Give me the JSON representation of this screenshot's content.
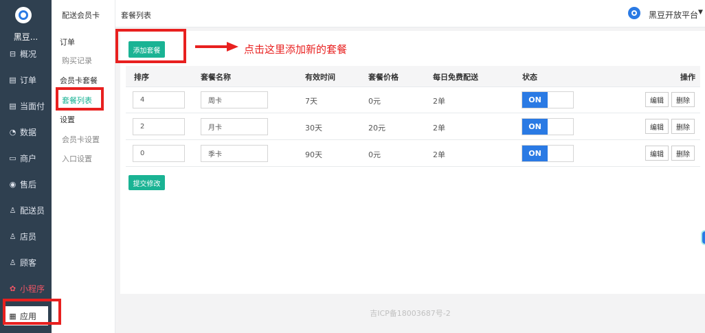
{
  "sidebar": {
    "brand": "黑豆...",
    "items": [
      {
        "label": "概况",
        "icon": "overview-icon",
        "glyph": "⊟"
      },
      {
        "label": "订单",
        "icon": "order-icon",
        "glyph": "▤"
      },
      {
        "label": "当面付",
        "icon": "face-pay-icon",
        "glyph": "▤"
      },
      {
        "label": "数据",
        "icon": "data-icon",
        "glyph": "◔"
      },
      {
        "label": "商户",
        "icon": "merchant-icon",
        "glyph": "▭"
      },
      {
        "label": "售后",
        "icon": "after-sale-icon",
        "glyph": "◉"
      },
      {
        "label": "配送员",
        "icon": "courier-icon",
        "glyph": "♙"
      },
      {
        "label": "店员",
        "icon": "clerk-icon",
        "glyph": "♙"
      },
      {
        "label": "顾客",
        "icon": "customer-icon",
        "glyph": "♙"
      },
      {
        "label": "小程序",
        "icon": "mini-program-icon",
        "glyph": "✿"
      },
      {
        "label": "应用",
        "icon": "apps-icon",
        "glyph": "▦"
      }
    ]
  },
  "submenu": {
    "title": "配送会员卡",
    "groups": [
      {
        "label": "订单"
      },
      {
        "label": "会员卡套餐"
      },
      {
        "label": "设置"
      }
    ],
    "links": [
      {
        "label": "购买记录"
      },
      {
        "label": "套餐列表"
      },
      {
        "label": "会员卡设置"
      },
      {
        "label": "入口设置"
      }
    ]
  },
  "topbar": {
    "title": "套餐列表",
    "user": "黑豆开放平台"
  },
  "main": {
    "add_button": "添加套餐",
    "annotation": "点击这里添加新的套餐",
    "columns": [
      "排序",
      "套餐名称",
      "有效时间",
      "套餐价格",
      "每日免费配送",
      "状态",
      "操作"
    ],
    "rows": [
      {
        "order": "4",
        "name": "周卡",
        "duration": "7天",
        "price": "0元",
        "free": "2单",
        "status": "ON"
      },
      {
        "order": "2",
        "name": "月卡",
        "duration": "30天",
        "price": "20元",
        "free": "2单",
        "status": "ON"
      },
      {
        "order": "0",
        "name": "季卡",
        "duration": "90天",
        "price": "0元",
        "free": "2单",
        "status": "ON"
      }
    ],
    "edit_label": "编辑",
    "delete_label": "删除",
    "submit_button": "提交修改"
  },
  "footer": {
    "icp": "吉ICP备18003687号-2"
  },
  "colors": {
    "sidebar_bg": "#2f4050",
    "accent_green": "#1ab394",
    "toggle_blue": "#2a7ae4",
    "annotation_red": "#e8201f"
  }
}
